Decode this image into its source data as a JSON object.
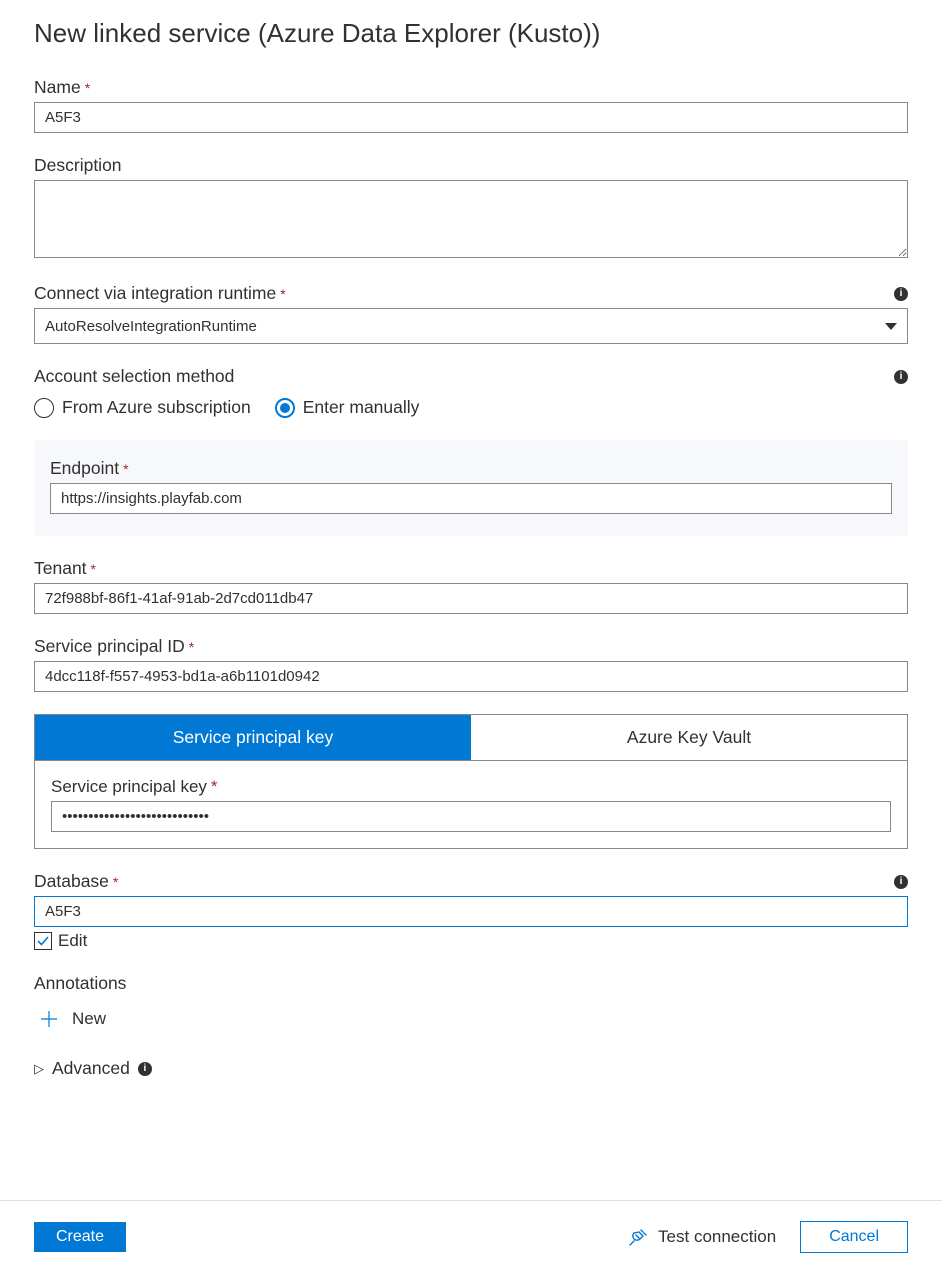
{
  "title": "New linked service (Azure Data Explorer (Kusto))",
  "fields": {
    "name": {
      "label": "Name",
      "value": "A5F3"
    },
    "description": {
      "label": "Description",
      "value": ""
    },
    "runtime": {
      "label": "Connect via integration runtime",
      "value": "AutoResolveIntegrationRuntime"
    },
    "accountMethod": {
      "label": "Account selection method",
      "options": {
        "subscription": "From Azure subscription",
        "manual": "Enter manually"
      },
      "selected": "manual"
    },
    "endpoint": {
      "label": "Endpoint",
      "value": "https://insights.playfab.com"
    },
    "tenant": {
      "label": "Tenant",
      "value": "72f988bf-86f1-41af-91ab-2d7cd011db47"
    },
    "spId": {
      "label": "Service principal ID",
      "value": "4dcc118f-f557-4953-bd1a-a6b1101d0942"
    },
    "spTabs": {
      "key": "Service principal key",
      "vault": "Azure Key Vault",
      "active": "key"
    },
    "spKey": {
      "label": "Service principal key",
      "value": "••••••••••••••••••••••••••••"
    },
    "database": {
      "label": "Database",
      "value": "A5F3",
      "editLabel": "Edit",
      "editChecked": true
    },
    "annotations": {
      "label": "Annotations",
      "newLabel": "New"
    },
    "advanced": {
      "label": "Advanced"
    }
  },
  "footer": {
    "create": "Create",
    "test": "Test connection",
    "cancel": "Cancel"
  }
}
